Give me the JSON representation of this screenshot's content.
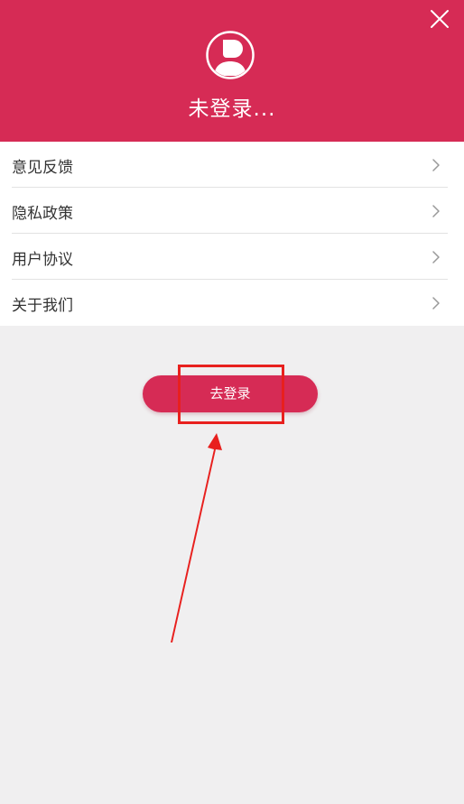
{
  "header": {
    "status_text": "未登录...",
    "accent_color": "#d62b55",
    "close_icon": "close-icon",
    "avatar_icon": "user-avatar-icon"
  },
  "menu": {
    "items": [
      {
        "label": "意见反馈"
      },
      {
        "label": "隐私政策"
      },
      {
        "label": "用户协议"
      },
      {
        "label": "关于我们"
      }
    ],
    "chevron_icon": "chevron-right-icon"
  },
  "login_button": {
    "label": "去登录"
  },
  "annotation": {
    "color": "#e8201e"
  }
}
